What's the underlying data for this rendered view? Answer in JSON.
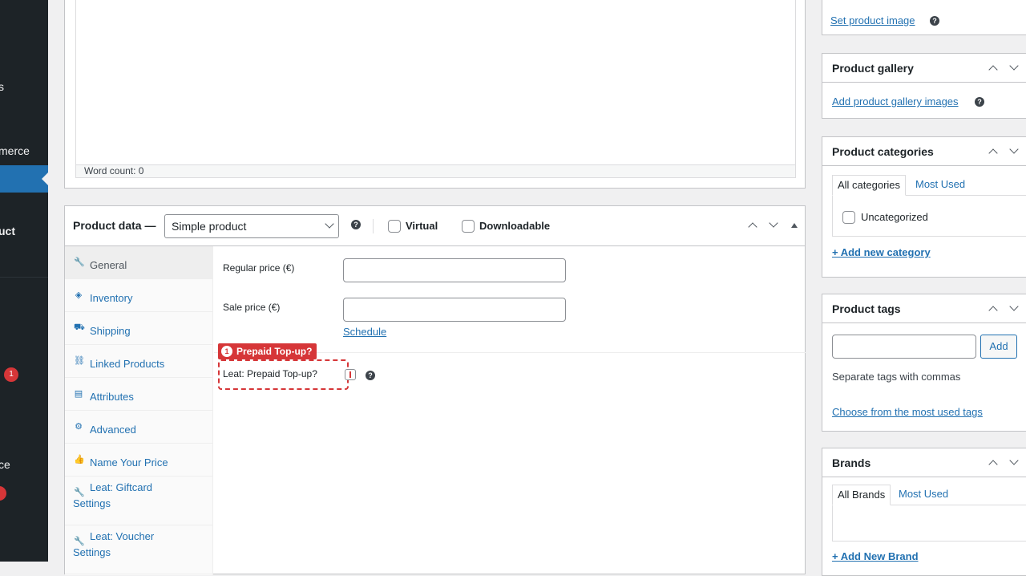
{
  "admin_menu": {
    "fragments": [
      "s",
      "merce",
      "uct",
      "ce"
    ],
    "badges": [
      "1"
    ]
  },
  "editor": {
    "word_count": "Word count: 0"
  },
  "product_data": {
    "title": "Product data —",
    "product_type": "Simple product",
    "help": "?",
    "virtual_label": "Virtual",
    "downloadable_label": "Downloadable",
    "tabs": [
      {
        "icon": "wrench-icon",
        "glyph": "🔧",
        "label": "General",
        "active": true
      },
      {
        "icon": "tag-icon",
        "glyph": "◈",
        "label": "Inventory"
      },
      {
        "icon": "truck-icon",
        "glyph": "⛟",
        "label": "Shipping"
      },
      {
        "icon": "link-icon",
        "glyph": "⛓",
        "label": "Linked Products"
      },
      {
        "icon": "list-icon",
        "glyph": "▤",
        "label": "Attributes"
      },
      {
        "icon": "gear-icon",
        "glyph": "⚙",
        "label": "Advanced"
      },
      {
        "icon": "thumbs-up-icon",
        "glyph": "👍",
        "label": "Name Your Price"
      },
      {
        "icon": "wrench-icon",
        "glyph": "🔧",
        "label": "Leat: Giftcard",
        "label2": "Settings"
      },
      {
        "icon": "wrench-icon",
        "glyph": "🔧",
        "label": "Leat: Voucher",
        "label2": "Settings"
      }
    ],
    "general": {
      "regular_price_label": "Regular price (€)",
      "regular_price_value": "",
      "sale_price_label": "Sale price (€)",
      "sale_price_value": "",
      "schedule_link": "Schedule",
      "topup_badge_number": "1",
      "topup_badge_text": "Prepaid Top-up?",
      "topup_label": "Leat: Prepaid Top-up?"
    }
  },
  "sidebar": {
    "product_image_link": "Set product image",
    "gallery": {
      "title": "Product gallery",
      "link": "Add product gallery images"
    },
    "categories": {
      "title": "Product categories",
      "tabs": [
        "All categories",
        "Most Used"
      ],
      "items": [
        "Uncategorized"
      ],
      "add_link": "+ Add new category"
    },
    "tags": {
      "title": "Product tags",
      "input_value": "",
      "add_button": "Add",
      "hint": "Separate tags with commas",
      "choose_link": "Choose from the most used tags"
    },
    "brands": {
      "title": "Brands",
      "tabs": [
        "All Brands",
        "Most Used"
      ],
      "add_link": "+ Add New Brand"
    }
  }
}
